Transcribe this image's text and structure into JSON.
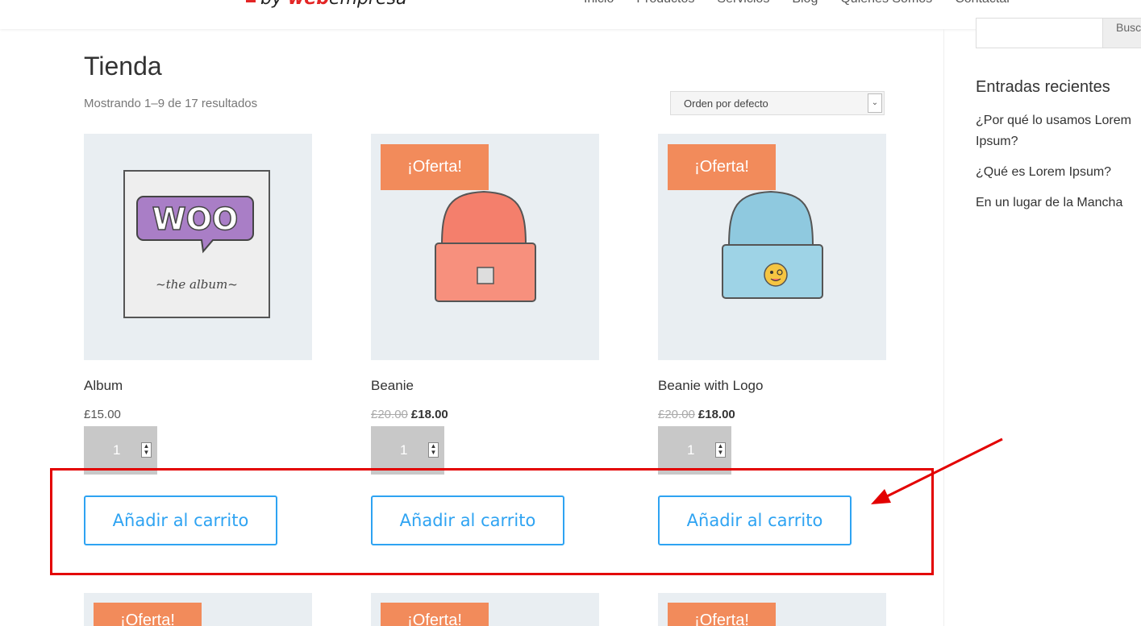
{
  "header": {
    "logo_prefix": "by",
    "logo_brand": "web",
    "logo_suffix": "empresa",
    "nav": [
      "Inicio",
      "Productos",
      "Servicios",
      "Blog",
      "Quiénes Somos",
      "Contactar"
    ]
  },
  "shop": {
    "title": "Tienda",
    "result_count": "Mostrando 1–9 de 17 resultados",
    "sort_value": "Orden por defecto"
  },
  "products": [
    {
      "name": "Album",
      "price": "£15.00",
      "old_price": "",
      "sale_price": "",
      "badge": "",
      "qty": "1",
      "button": "Añadir al carrito"
    },
    {
      "name": "Beanie",
      "price": "",
      "old_price": "£20.00",
      "sale_price": "£18.00",
      "badge": "¡Oferta!",
      "qty": "1",
      "button": "Añadir al carrito"
    },
    {
      "name": "Beanie with Logo",
      "price": "",
      "old_price": "£20.00",
      "sale_price": "£18.00",
      "badge": "¡Oferta!",
      "qty": "1",
      "button": "Añadir al carrito"
    }
  ],
  "next_row_badges": [
    "¡Oferta!",
    "¡Oferta!",
    "¡Oferta!"
  ],
  "album_art": {
    "logo": "WOO",
    "caption": "~the album~"
  },
  "sidebar": {
    "search_button": "Buscar",
    "widget_title": "Entradas recientes",
    "recent_posts": [
      "¿Por qué lo usamos Lorem Ipsum?",
      "¿Qué es Lorem Ipsum?",
      "En un lugar de la Mancha"
    ]
  },
  "colors": {
    "accent": "#2ea3f2",
    "sale_badge": "#f28b5b",
    "annotation": "#e30000",
    "placeholder_bg": "#e9eef2"
  }
}
